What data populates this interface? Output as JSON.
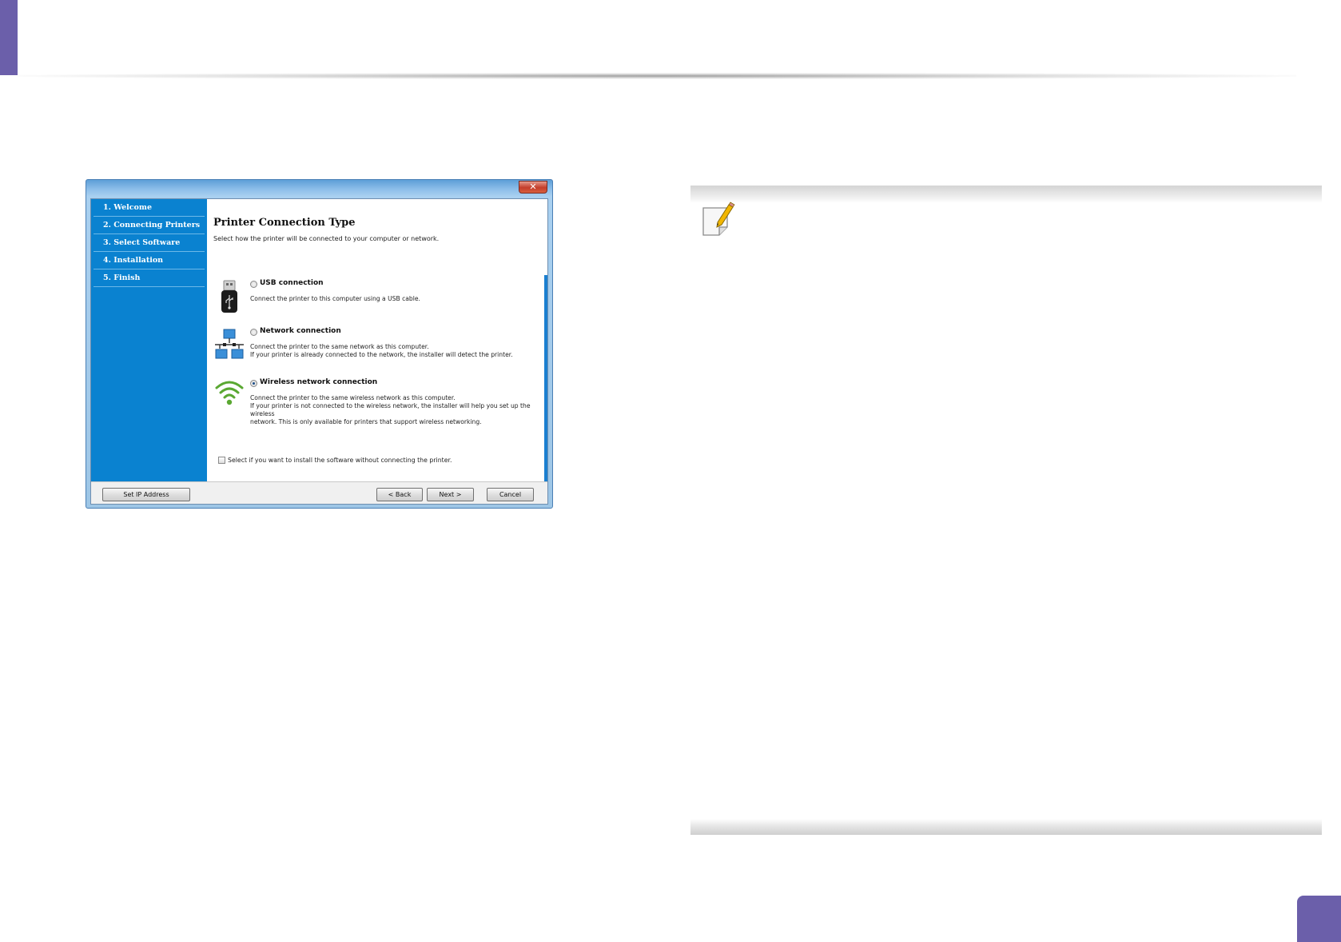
{
  "window": {
    "close_glyph": "✕"
  },
  "sidebar": {
    "items": [
      {
        "label": "1. Welcome"
      },
      {
        "label": "2. Connecting Printers"
      },
      {
        "label": "3. Select Software"
      },
      {
        "label": "4. Installation"
      },
      {
        "label": "5. Finish"
      }
    ]
  },
  "main": {
    "title": "Printer Connection Type",
    "subtitle": "Select how the printer will be connected to your computer or network.",
    "options": [
      {
        "label": "USB connection",
        "selected": false,
        "icon": "usb-drive-icon",
        "description": "Connect the printer to this computer using a USB cable."
      },
      {
        "label": "Network connection",
        "selected": false,
        "icon": "network-icon",
        "description_lines": [
          "Connect the printer to the same network as this computer.",
          "If your printer is already connected to the network, the installer will detect the printer."
        ]
      },
      {
        "label": "Wireless network connection",
        "selected": true,
        "icon": "wifi-icon",
        "description_lines": [
          "Connect the printer to the same wireless network as this computer.",
          "If your printer is not connected to the wireless network, the installer will help you set up the wireless",
          "network. This is only available for printers that support wireless networking."
        ]
      }
    ],
    "skip_checkbox_label": "Select if you want to install the software without connecting the printer.",
    "skip_checked": false
  },
  "footer": {
    "set_ip": "Set IP Address",
    "back": "< Back",
    "next": "Next >",
    "cancel": "Cancel"
  },
  "colors": {
    "accent": "#6b5faa",
    "sidebar": "#0a82d0"
  },
  "note": {
    "icon": "note-pencil-icon"
  }
}
